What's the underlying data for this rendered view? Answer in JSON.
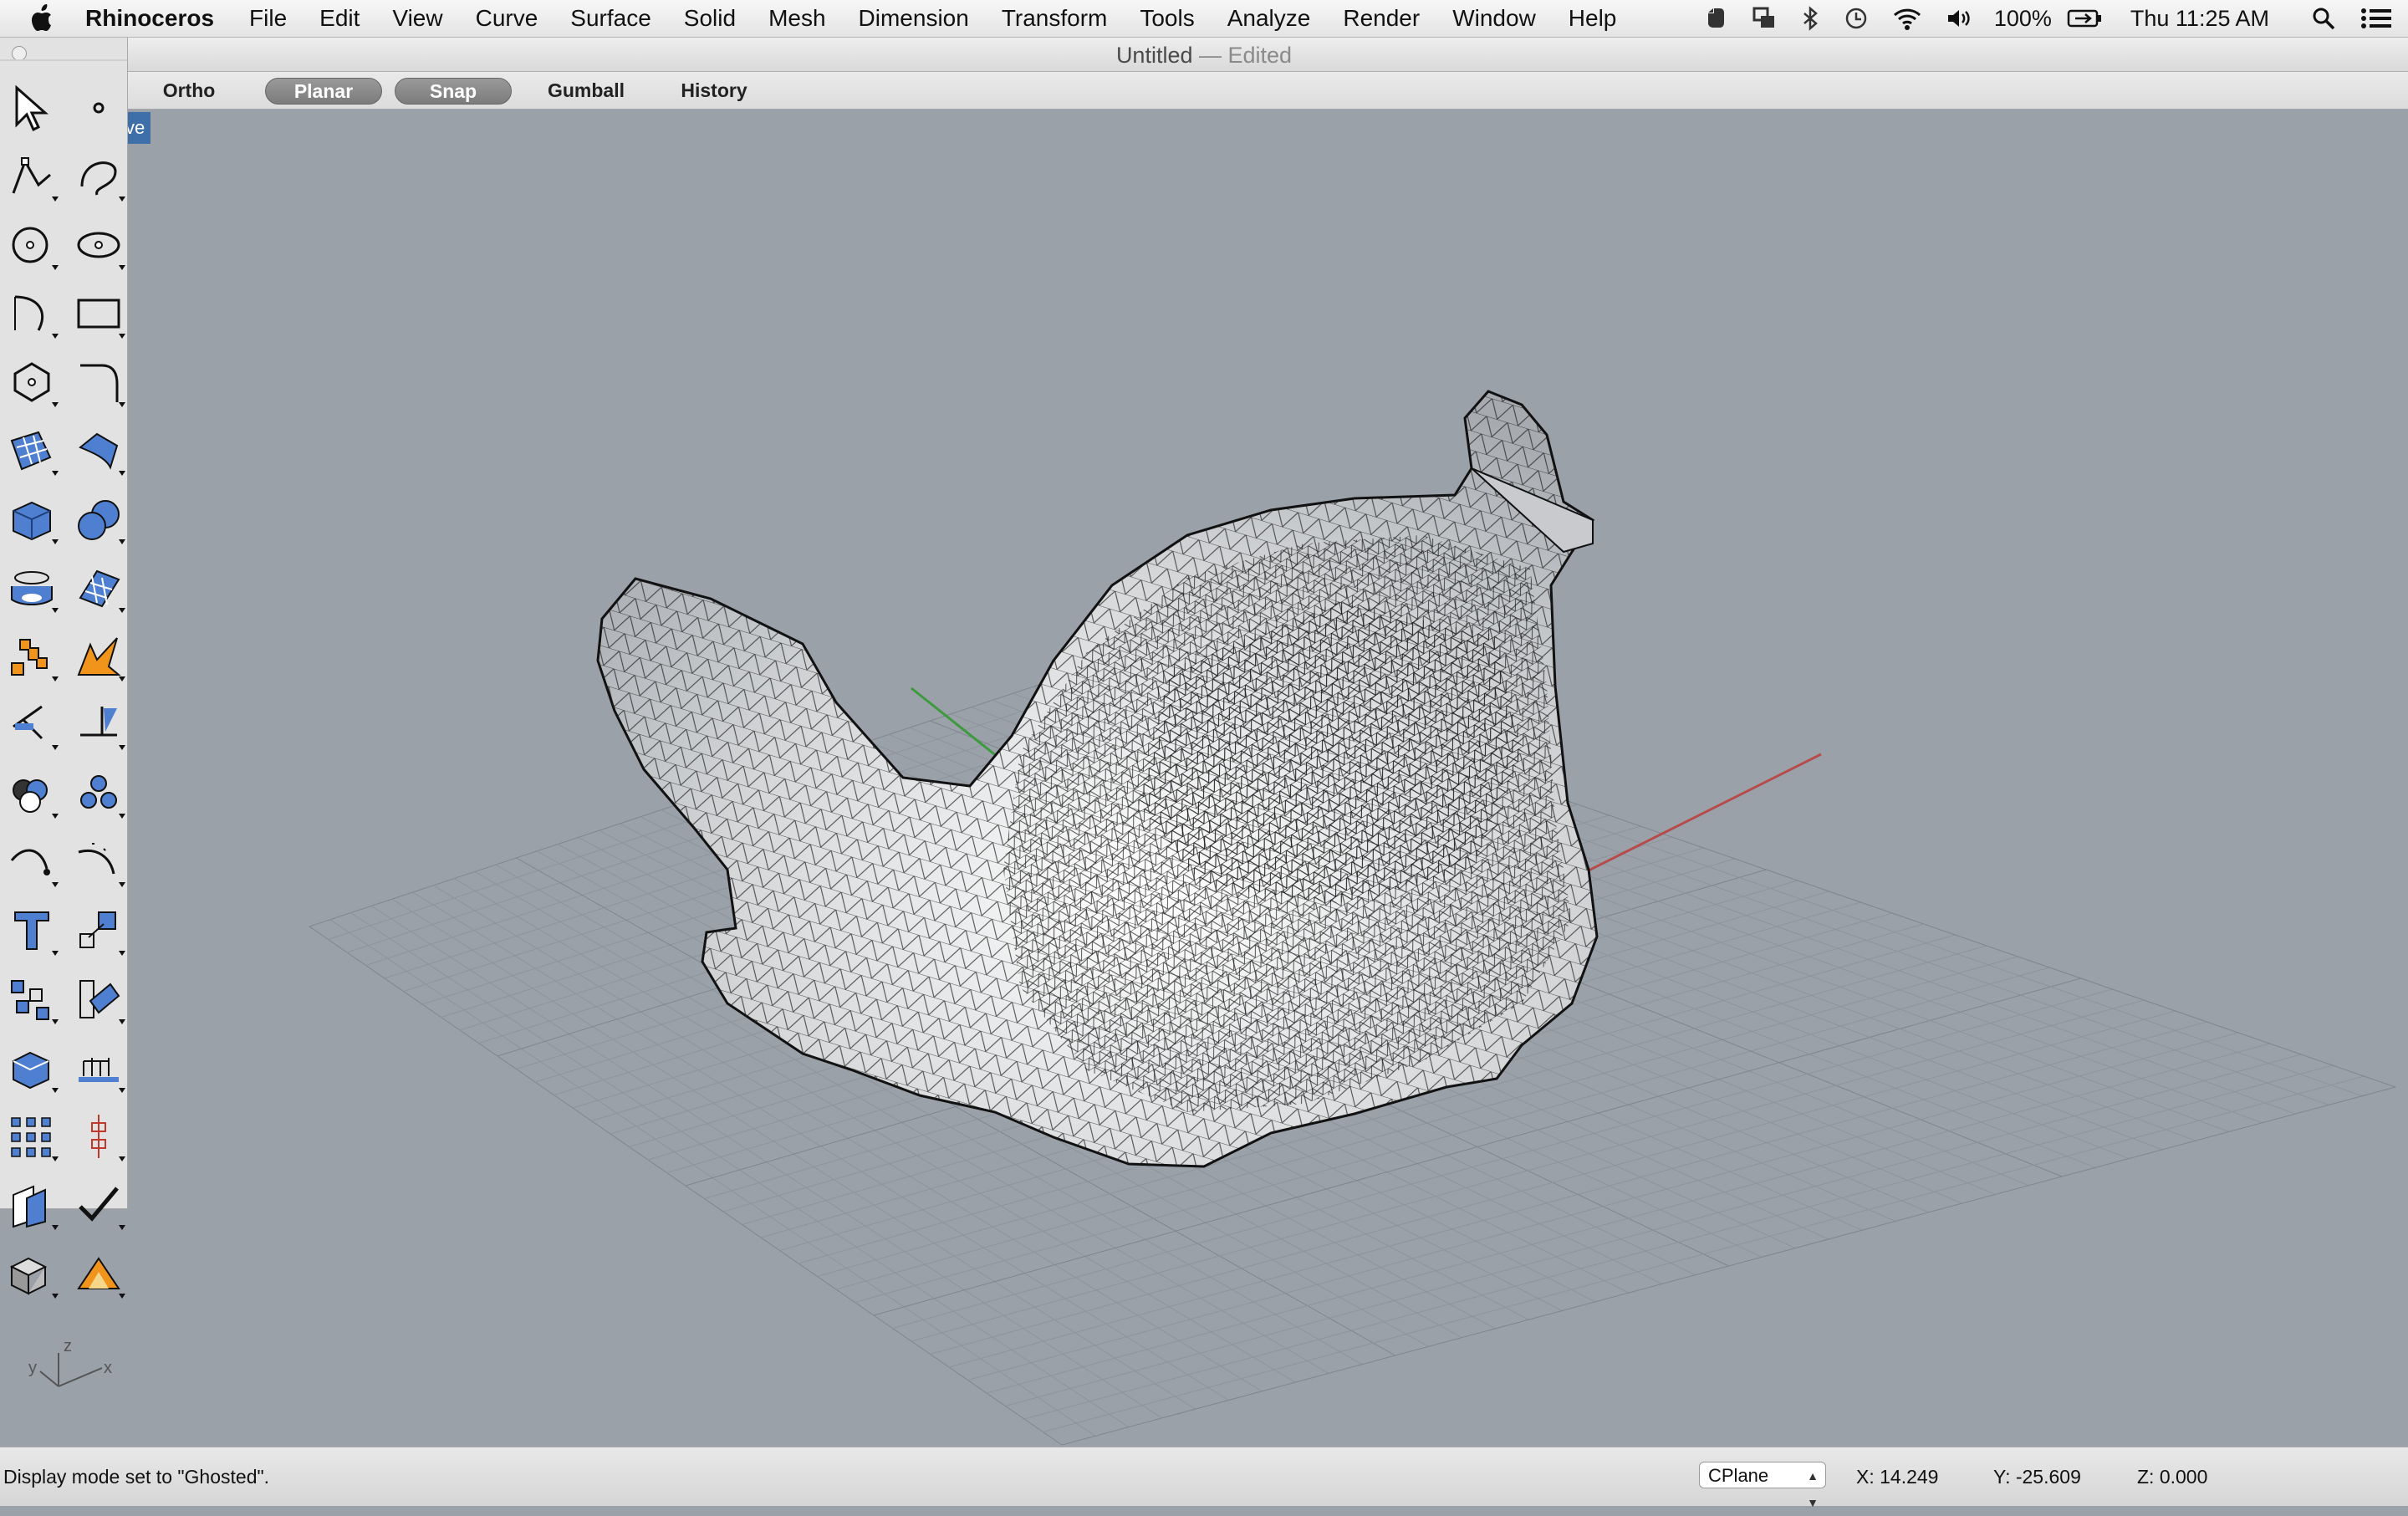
{
  "menubar": {
    "app_name": "Rhinoceros",
    "items": [
      "File",
      "Edit",
      "View",
      "Curve",
      "Surface",
      "Solid",
      "Mesh",
      "Dimension",
      "Transform",
      "Tools",
      "Analyze",
      "Render",
      "Window",
      "Help"
    ],
    "battery": "100%",
    "clock": "Thu 11:25 AM",
    "status_icons": [
      "evernote-icon",
      "screen-icon",
      "bluetooth-icon",
      "time-machine-icon",
      "wifi-icon",
      "volume-icon",
      "battery-icon",
      "spotlight-icon",
      "notification-list-icon"
    ]
  },
  "window": {
    "title": "Untitled",
    "separator": " — ",
    "state": "Edited"
  },
  "toolbar": {
    "ortho": "Ortho",
    "planar": "Planar",
    "snap": "Snap",
    "gumball": "Gumball",
    "history": "History"
  },
  "viewport": {
    "label_fragment": "ve",
    "axis_labels": {
      "z": "z",
      "y": "y",
      "x": "x"
    }
  },
  "palette": {
    "tools": [
      "select-arrow",
      "point",
      "polyline",
      "curve",
      "circle",
      "ellipse",
      "arc",
      "rectangle",
      "polygon",
      "fillet",
      "surface-from-points",
      "extrude-surface",
      "box",
      "sphere",
      "cylinder",
      "mesh-plane",
      "puzzle-shape",
      "explode",
      "trim",
      "split",
      "boolean-union",
      "boolean-split",
      "curve-offset",
      "curve-blend",
      "text",
      "scale",
      "transform-group",
      "project",
      "solid-box",
      "dimension-stairs",
      "array",
      "gumball",
      "frame",
      "check",
      "shade",
      "rendered"
    ]
  },
  "statusbar": {
    "message": "Display mode set to \"Ghosted\".",
    "cplane": "CPlane",
    "x": "X: 14.249",
    "y": "Y: -25.609",
    "z": "Z: 0.000"
  },
  "colors": {
    "viewport_bg": "#9aa1a9",
    "x_axis": "#b84a4a",
    "y_axis": "#3e9a3e",
    "grid": "#8d949c"
  }
}
